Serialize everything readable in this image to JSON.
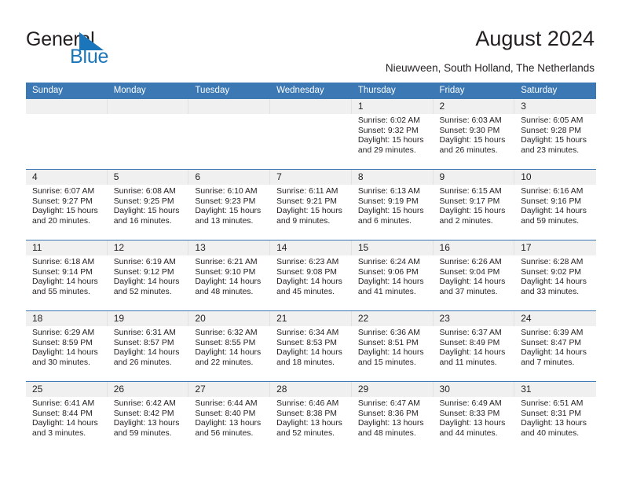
{
  "brand": {
    "name_part1": "General",
    "name_part2": "Blue",
    "triangle_color": "#1b75bb",
    "text_color": "#231f20"
  },
  "header": {
    "title": "August 2024",
    "subtitle": "Nieuwveen, South Holland, The Netherlands"
  },
  "theme": {
    "header_blue": "#3b78b4",
    "daynum_band": "#f0f0f0",
    "text": "#231f20"
  },
  "calendar": {
    "weekday_headers": [
      "Sunday",
      "Monday",
      "Tuesday",
      "Wednesday",
      "Thursday",
      "Friday",
      "Saturday"
    ],
    "weeks": [
      [
        {
          "day": "",
          "empty": true
        },
        {
          "day": "",
          "empty": true
        },
        {
          "day": "",
          "empty": true
        },
        {
          "day": "",
          "empty": true
        },
        {
          "day": "1",
          "sunrise": "Sunrise: 6:02 AM",
          "sunset": "Sunset: 9:32 PM",
          "daylight_line1": "Daylight: 15 hours",
          "daylight_line2": "and 29 minutes."
        },
        {
          "day": "2",
          "sunrise": "Sunrise: 6:03 AM",
          "sunset": "Sunset: 9:30 PM",
          "daylight_line1": "Daylight: 15 hours",
          "daylight_line2": "and 26 minutes."
        },
        {
          "day": "3",
          "sunrise": "Sunrise: 6:05 AM",
          "sunset": "Sunset: 9:28 PM",
          "daylight_line1": "Daylight: 15 hours",
          "daylight_line2": "and 23 minutes."
        }
      ],
      [
        {
          "day": "4",
          "sunrise": "Sunrise: 6:07 AM",
          "sunset": "Sunset: 9:27 PM",
          "daylight_line1": "Daylight: 15 hours",
          "daylight_line2": "and 20 minutes."
        },
        {
          "day": "5",
          "sunrise": "Sunrise: 6:08 AM",
          "sunset": "Sunset: 9:25 PM",
          "daylight_line1": "Daylight: 15 hours",
          "daylight_line2": "and 16 minutes."
        },
        {
          "day": "6",
          "sunrise": "Sunrise: 6:10 AM",
          "sunset": "Sunset: 9:23 PM",
          "daylight_line1": "Daylight: 15 hours",
          "daylight_line2": "and 13 minutes."
        },
        {
          "day": "7",
          "sunrise": "Sunrise: 6:11 AM",
          "sunset": "Sunset: 9:21 PM",
          "daylight_line1": "Daylight: 15 hours",
          "daylight_line2": "and 9 minutes."
        },
        {
          "day": "8",
          "sunrise": "Sunrise: 6:13 AM",
          "sunset": "Sunset: 9:19 PM",
          "daylight_line1": "Daylight: 15 hours",
          "daylight_line2": "and 6 minutes."
        },
        {
          "day": "9",
          "sunrise": "Sunrise: 6:15 AM",
          "sunset": "Sunset: 9:17 PM",
          "daylight_line1": "Daylight: 15 hours",
          "daylight_line2": "and 2 minutes."
        },
        {
          "day": "10",
          "sunrise": "Sunrise: 6:16 AM",
          "sunset": "Sunset: 9:16 PM",
          "daylight_line1": "Daylight: 14 hours",
          "daylight_line2": "and 59 minutes."
        }
      ],
      [
        {
          "day": "11",
          "sunrise": "Sunrise: 6:18 AM",
          "sunset": "Sunset: 9:14 PM",
          "daylight_line1": "Daylight: 14 hours",
          "daylight_line2": "and 55 minutes."
        },
        {
          "day": "12",
          "sunrise": "Sunrise: 6:19 AM",
          "sunset": "Sunset: 9:12 PM",
          "daylight_line1": "Daylight: 14 hours",
          "daylight_line2": "and 52 minutes."
        },
        {
          "day": "13",
          "sunrise": "Sunrise: 6:21 AM",
          "sunset": "Sunset: 9:10 PM",
          "daylight_line1": "Daylight: 14 hours",
          "daylight_line2": "and 48 minutes."
        },
        {
          "day": "14",
          "sunrise": "Sunrise: 6:23 AM",
          "sunset": "Sunset: 9:08 PM",
          "daylight_line1": "Daylight: 14 hours",
          "daylight_line2": "and 45 minutes."
        },
        {
          "day": "15",
          "sunrise": "Sunrise: 6:24 AM",
          "sunset": "Sunset: 9:06 PM",
          "daylight_line1": "Daylight: 14 hours",
          "daylight_line2": "and 41 minutes."
        },
        {
          "day": "16",
          "sunrise": "Sunrise: 6:26 AM",
          "sunset": "Sunset: 9:04 PM",
          "daylight_line1": "Daylight: 14 hours",
          "daylight_line2": "and 37 minutes."
        },
        {
          "day": "17",
          "sunrise": "Sunrise: 6:28 AM",
          "sunset": "Sunset: 9:02 PM",
          "daylight_line1": "Daylight: 14 hours",
          "daylight_line2": "and 33 minutes."
        }
      ],
      [
        {
          "day": "18",
          "sunrise": "Sunrise: 6:29 AM",
          "sunset": "Sunset: 8:59 PM",
          "daylight_line1": "Daylight: 14 hours",
          "daylight_line2": "and 30 minutes."
        },
        {
          "day": "19",
          "sunrise": "Sunrise: 6:31 AM",
          "sunset": "Sunset: 8:57 PM",
          "daylight_line1": "Daylight: 14 hours",
          "daylight_line2": "and 26 minutes."
        },
        {
          "day": "20",
          "sunrise": "Sunrise: 6:32 AM",
          "sunset": "Sunset: 8:55 PM",
          "daylight_line1": "Daylight: 14 hours",
          "daylight_line2": "and 22 minutes."
        },
        {
          "day": "21",
          "sunrise": "Sunrise: 6:34 AM",
          "sunset": "Sunset: 8:53 PM",
          "daylight_line1": "Daylight: 14 hours",
          "daylight_line2": "and 18 minutes."
        },
        {
          "day": "22",
          "sunrise": "Sunrise: 6:36 AM",
          "sunset": "Sunset: 8:51 PM",
          "daylight_line1": "Daylight: 14 hours",
          "daylight_line2": "and 15 minutes."
        },
        {
          "day": "23",
          "sunrise": "Sunrise: 6:37 AM",
          "sunset": "Sunset: 8:49 PM",
          "daylight_line1": "Daylight: 14 hours",
          "daylight_line2": "and 11 minutes."
        },
        {
          "day": "24",
          "sunrise": "Sunrise: 6:39 AM",
          "sunset": "Sunset: 8:47 PM",
          "daylight_line1": "Daylight: 14 hours",
          "daylight_line2": "and 7 minutes."
        }
      ],
      [
        {
          "day": "25",
          "sunrise": "Sunrise: 6:41 AM",
          "sunset": "Sunset: 8:44 PM",
          "daylight_line1": "Daylight: 14 hours",
          "daylight_line2": "and 3 minutes."
        },
        {
          "day": "26",
          "sunrise": "Sunrise: 6:42 AM",
          "sunset": "Sunset: 8:42 PM",
          "daylight_line1": "Daylight: 13 hours",
          "daylight_line2": "and 59 minutes."
        },
        {
          "day": "27",
          "sunrise": "Sunrise: 6:44 AM",
          "sunset": "Sunset: 8:40 PM",
          "daylight_line1": "Daylight: 13 hours",
          "daylight_line2": "and 56 minutes."
        },
        {
          "day": "28",
          "sunrise": "Sunrise: 6:46 AM",
          "sunset": "Sunset: 8:38 PM",
          "daylight_line1": "Daylight: 13 hours",
          "daylight_line2": "and 52 minutes."
        },
        {
          "day": "29",
          "sunrise": "Sunrise: 6:47 AM",
          "sunset": "Sunset: 8:36 PM",
          "daylight_line1": "Daylight: 13 hours",
          "daylight_line2": "and 48 minutes."
        },
        {
          "day": "30",
          "sunrise": "Sunrise: 6:49 AM",
          "sunset": "Sunset: 8:33 PM",
          "daylight_line1": "Daylight: 13 hours",
          "daylight_line2": "and 44 minutes."
        },
        {
          "day": "31",
          "sunrise": "Sunrise: 6:51 AM",
          "sunset": "Sunset: 8:31 PM",
          "daylight_line1": "Daylight: 13 hours",
          "daylight_line2": "and 40 minutes."
        }
      ]
    ]
  }
}
